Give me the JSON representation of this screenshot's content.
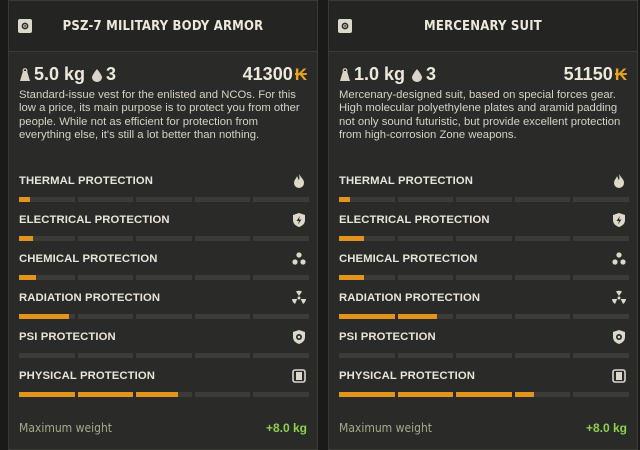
{
  "accent_color": "#e3941c",
  "currency_symbol": "₭",
  "items": [
    {
      "title": "PSZ-7 MILITARY BODY ARMOR",
      "weight": "5.0 kg",
      "slots": "3",
      "price": "41300",
      "description": "Standard-issue vest for the enlisted and NCOs. For this low a price, its main purpose is to protect you from other people. While not as efficient for protection from everything else, it's still a lot better than nothing.",
      "protections": [
        {
          "label": "THERMAL PROTECTION",
          "icon": "flame-icon",
          "level": 0.04
        },
        {
          "label": "ELECTRICAL PROTECTION",
          "icon": "shield-bolt-icon",
          "level": 0.05
        },
        {
          "label": "CHEMICAL PROTECTION",
          "icon": "biohazard-icon",
          "level": 0.06
        },
        {
          "label": "RADIATION PROTECTION",
          "icon": "radiation-icon",
          "level": 0.18
        },
        {
          "label": "PSI PROTECTION",
          "icon": "psi-shield-icon",
          "level": 0.0
        },
        {
          "label": "PHYSICAL PROTECTION",
          "icon": "armor-icon",
          "level": 0.55
        }
      ],
      "max_weight_label": "Maximum weight",
      "max_weight_value": "+8.0 kg"
    },
    {
      "title": "MERCENARY SUIT",
      "weight": "1.0 kg",
      "slots": "3",
      "price": "51150",
      "description": "Mercenary-designed suit, based on special forces gear. High molecular polyethylene plates and aramid padding not only sound futuristic, but provide excellent protection from high-corrosion Zone weapons.",
      "protections": [
        {
          "label": "THERMAL PROTECTION",
          "icon": "flame-icon",
          "level": 0.04
        },
        {
          "label": "ELECTRICAL PROTECTION",
          "icon": "shield-bolt-icon",
          "level": 0.09
        },
        {
          "label": "CHEMICAL PROTECTION",
          "icon": "biohazard-icon",
          "level": 0.09
        },
        {
          "label": "RADIATION PROTECTION",
          "icon": "radiation-icon",
          "level": 0.34
        },
        {
          "label": "PSI PROTECTION",
          "icon": "psi-shield-icon",
          "level": 0.0
        },
        {
          "label": "PHYSICAL PROTECTION",
          "icon": "armor-icon",
          "level": 0.67
        }
      ],
      "max_weight_label": "Maximum weight",
      "max_weight_value": "+8.0 kg"
    }
  ]
}
